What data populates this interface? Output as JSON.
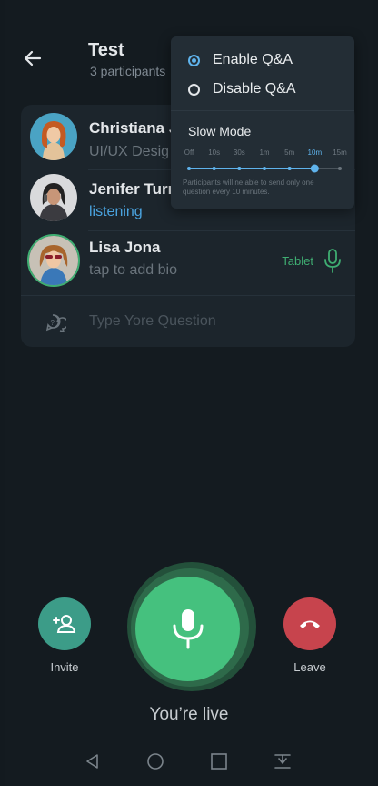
{
  "header": {
    "title": "Test",
    "subtitle": "3 participants"
  },
  "participants": [
    {
      "name": "Christiana J",
      "status": "UI/UX Desig"
    },
    {
      "name": "Jenifer Turn",
      "status": "listening"
    },
    {
      "name": "Lisa Jona",
      "status": "tap to add bio",
      "device": "Tablet"
    }
  ],
  "question_placeholder": "Type Yore Question",
  "menu": {
    "enable_label": "Enable Q&A",
    "disable_label": "Disable Q&A",
    "selected": "Enable Q&A",
    "slow_mode_title": "Slow Mode",
    "slow_mode_options": [
      "Off",
      "10s",
      "30s",
      "1m",
      "5m",
      "10m",
      "15m"
    ],
    "slow_mode_selected": "10m",
    "slow_mode_note": "Participants will ne able to send only one question every 10 minutes."
  },
  "controls": {
    "invite_label": "Invite",
    "leave_label": "Leave",
    "live_status": "You’re live"
  },
  "colors": {
    "accent_blue": "#5fb3ec",
    "mic_green": "#45c17e",
    "invite_teal": "#3c9c88",
    "leave_red": "#c7444d"
  },
  "icons": {
    "back": "arrow-left-icon",
    "question": "question-bubble-icon",
    "mic": "microphone-icon",
    "invite": "add-user-icon",
    "leave": "hang-up-icon"
  }
}
